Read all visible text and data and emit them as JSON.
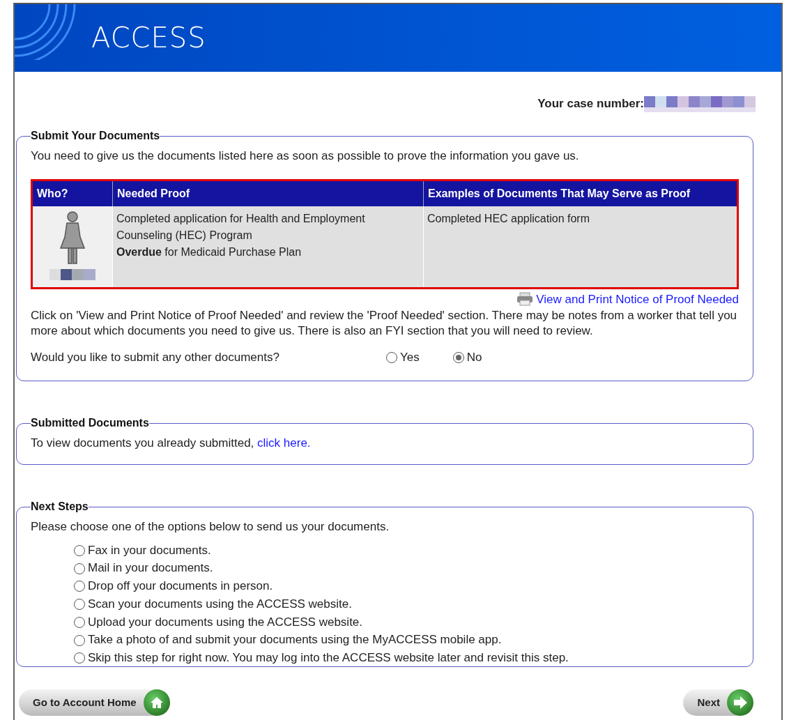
{
  "header": {
    "title": "ACCESS"
  },
  "case_number": {
    "label": "Your case number:"
  },
  "submit_documents": {
    "legend": "Submit Your Documents",
    "intro": "You need to give us the documents listed here as soon as possible to prove the information you gave us.",
    "table": {
      "columns": [
        "Who?",
        "Needed Proof",
        "Examples of Documents That May Serve as Proof"
      ],
      "rows": [
        {
          "needed_proof": [
            "Completed application for Health and Employment Counseling (HEC) Program",
            "**Overdue** for Medicaid Purchase Plan"
          ],
          "examples": "Completed HEC application form"
        }
      ]
    },
    "print_link": "View and Print Notice of Proof Needed",
    "instructions": "Click on 'View and Print Notice of Proof Needed' and review the 'Proof Needed' section. There may be notes from a worker that tell you more about which documents you need to give us. There is also an FYI section that you will need to review.",
    "question": {
      "text": "Would you like to submit any other documents?",
      "options": [
        {
          "label": "Yes",
          "selected": false
        },
        {
          "label": "No",
          "selected": true
        }
      ]
    }
  },
  "submitted_documents": {
    "legend": "Submitted Documents",
    "text": "To view documents you already submitted,",
    "link": "click here."
  },
  "next_steps": {
    "legend": "Next Steps",
    "intro": "Please choose one of the options below to send us your documents.",
    "options": [
      {
        "label": "Fax in your documents.",
        "selected": false
      },
      {
        "label": "Mail in your documents.",
        "selected": false
      },
      {
        "label": "Drop off your documents in person.",
        "selected": false
      },
      {
        "label": "Scan your documents using the ACCESS website.",
        "selected": false
      },
      {
        "label": "Upload your documents using the ACCESS website.",
        "selected": false
      },
      {
        "label": "Take a photo of and submit your documents using the MyACCESS mobile app.",
        "selected": false
      },
      {
        "label": "Skip this step for right now. You may log into the ACCESS website later and revisit this step.",
        "selected": false
      }
    ]
  },
  "buttons": [
    {
      "label": "Go to Account Home",
      "kind": "home"
    },
    {
      "label": "Next",
      "kind": "next"
    }
  ]
}
